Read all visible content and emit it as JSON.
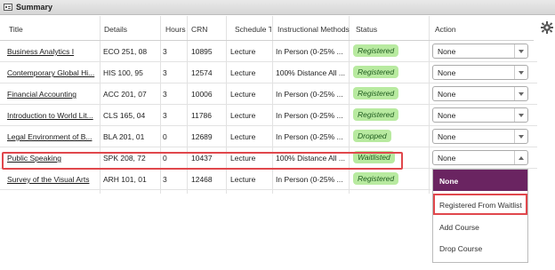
{
  "panel": {
    "title": "Summary"
  },
  "columns": [
    "Title",
    "Details",
    "Hours",
    "CRN",
    "Schedule T",
    "Instructional Methods",
    "Status",
    "Action"
  ],
  "rows": [
    {
      "title": "Business Analytics I",
      "details": "ECO 251, 08",
      "hours": "3",
      "crn": "10895",
      "schedule": "Lecture",
      "method": "In Person (0-25% ...",
      "status": "Registered",
      "action": "None"
    },
    {
      "title": "Contemporary Global Hi...",
      "details": "HIS 100, 95",
      "hours": "3",
      "crn": "12574",
      "schedule": "Lecture",
      "method": "100% Distance All ...",
      "status": "Registered",
      "action": "None"
    },
    {
      "title": "Financial Accounting",
      "details": "ACC 201, 07",
      "hours": "3",
      "crn": "10006",
      "schedule": "Lecture",
      "method": "In Person (0-25% ...",
      "status": "Registered",
      "action": "None"
    },
    {
      "title": "Introduction to World Lit...",
      "details": "CLS 165, 04",
      "hours": "3",
      "crn": "11786",
      "schedule": "Lecture",
      "method": "In Person (0-25% ...",
      "status": "Registered",
      "action": "None"
    },
    {
      "title": "Legal Environment of B...",
      "details": "BLA 201, 01",
      "hours": "0",
      "crn": "12689",
      "schedule": "Lecture",
      "method": "In Person (0-25% ...",
      "status": "Dropped",
      "action": "None"
    },
    {
      "title": "Public Speaking",
      "details": "SPK 208, 72",
      "hours": "0",
      "crn": "10437",
      "schedule": "Lecture",
      "method": "100% Distance All ...",
      "status": "Waitlisted",
      "action": "None"
    },
    {
      "title": "Survey of the Visual Arts",
      "details": "ARH 101, 01",
      "hours": "3",
      "crn": "12468",
      "schedule": "Lecture",
      "method": "In Person (0-25% ...",
      "status": "Registered",
      "action": "None"
    }
  ],
  "dropdown": {
    "options": [
      "None",
      "Registered From Waitlist",
      "Add Course",
      "Drop Course"
    ]
  },
  "icons": {
    "settings": "gear-icon",
    "panel": "table-icon"
  },
  "colors": {
    "status_bg": "#b8eaa0",
    "selected_option": "#6a2461",
    "highlight": "#e0474c"
  }
}
